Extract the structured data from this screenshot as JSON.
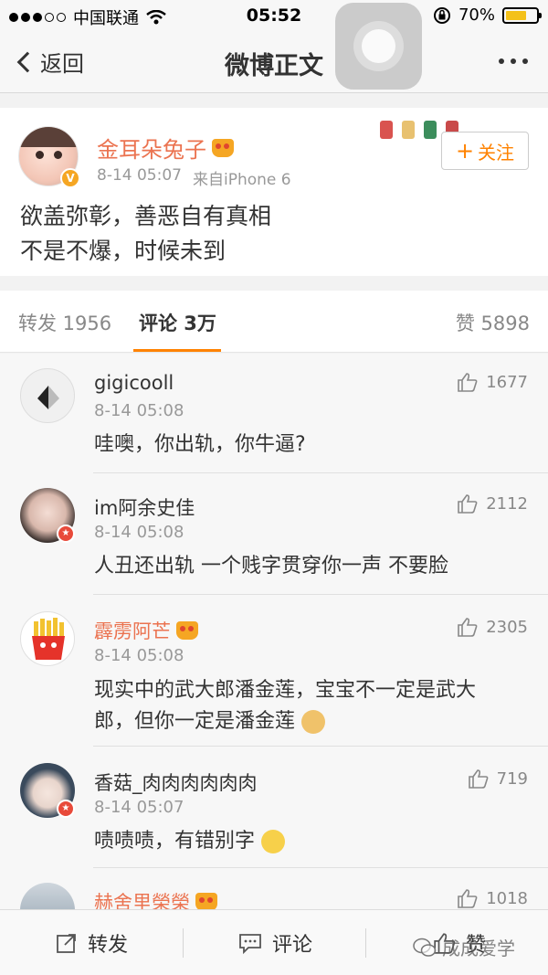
{
  "status_bar": {
    "carrier": "中国联通",
    "time": "05:52",
    "battery_text": "70%",
    "battery_level": 0.7
  },
  "nav": {
    "back_label": "返回",
    "title": "微博正文"
  },
  "post": {
    "author": "金耳朵兔子",
    "time": "8-14 05:07",
    "source": "来自iPhone 6",
    "text_line1": "欲盖弥彰，善恶自有真相",
    "text_line2": "不是不爆，时候未到",
    "follow_label": "关注"
  },
  "tabs": {
    "repost": "转发 1956",
    "comment": "评论 3万",
    "like": "赞 5898"
  },
  "comments": [
    {
      "name": "gigicooll",
      "time": "8-14 05:08",
      "text": "哇噢，你出轨，你牛逼?",
      "likes": "1677"
    },
    {
      "name": "im阿余史佳",
      "time": "8-14 05:08",
      "text": "人丑还出轨 一个贱字贯穿你一声 不要脸",
      "likes": "2112"
    },
    {
      "name": "霹雳阿芒",
      "time": "8-14 05:08",
      "text_line1": "现实中的武大郎潘金莲，宝宝不一定是武大",
      "text_line2": "郎，但你一定是潘金莲",
      "likes": "2305"
    },
    {
      "name": "香菇_肉肉肉肉肉肉",
      "time": "8-14 05:07",
      "text": "啧啧啧，有错别字",
      "likes": "719"
    },
    {
      "name": "赫舍里榮榮",
      "likes": "1018"
    }
  ],
  "toolbar": {
    "repost_label": "转发",
    "comment_label": "评论",
    "like_label": "赞"
  },
  "watermark": "成成爱学",
  "colors": {
    "accent_orange": "#ff8200",
    "vip_name": "#eb7350",
    "battery": "#f4c11a"
  }
}
